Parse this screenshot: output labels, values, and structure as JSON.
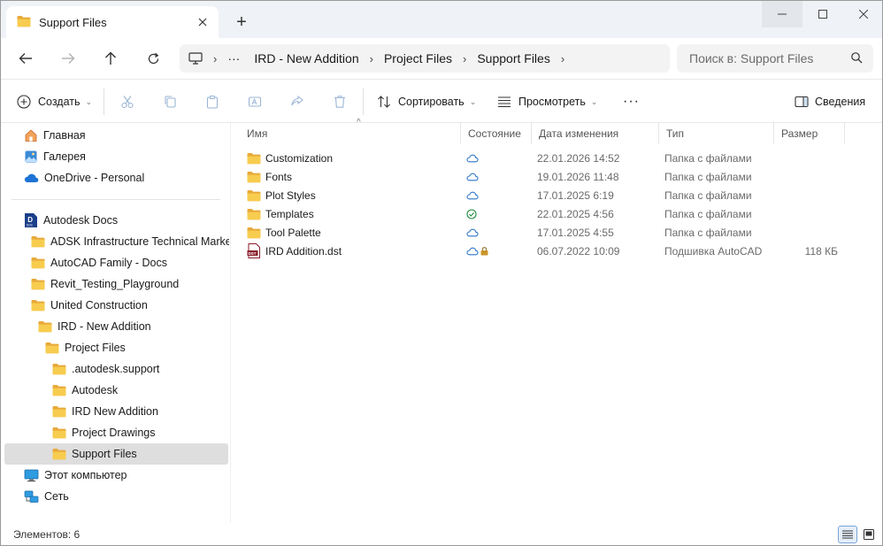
{
  "tab": {
    "title": "Support Files"
  },
  "window": {
    "new_tab": "+"
  },
  "breadcrumb": {
    "ellipsis": "···",
    "items": [
      "IRD - New Addition",
      "Project Files",
      "Support Files"
    ]
  },
  "search": {
    "placeholder": "Поиск в: Support Files"
  },
  "toolbar": {
    "create": "Создать",
    "sort": "Сортировать",
    "view": "Просмотреть",
    "more": "···",
    "details": "Сведения"
  },
  "sidebar": {
    "home": "Главная",
    "gallery": "Галерея",
    "onedrive": "OneDrive - Personal",
    "autodesk_docs": "Autodesk Docs",
    "folders": [
      "ADSK Infrastructure Technical Marketing",
      "AutoCAD Family - Docs",
      "Revit_Testing_Playground",
      "United Construction",
      "IRD - New Addition",
      "Project Files",
      ".autodesk.support",
      "Autodesk",
      "IRD New Addition",
      "Project Drawings",
      "Support Files"
    ],
    "this_pc": "Этот компьютер",
    "network": "Сеть"
  },
  "columns": {
    "name": "Имя",
    "state": "Состояние",
    "date": "Дата изменения",
    "type": "Тип",
    "size": "Размер"
  },
  "files": [
    {
      "name": "Customization",
      "state": "cloud",
      "date": "22.01.2026 14:52",
      "type": "Папка с файлами",
      "size": ""
    },
    {
      "name": "Fonts",
      "state": "cloud",
      "date": "19.01.2026 11:48",
      "type": "Папка с файлами",
      "size": ""
    },
    {
      "name": "Plot Styles",
      "state": "cloud",
      "date": "17.01.2025 6:19",
      "type": "Папка с файлами",
      "size": ""
    },
    {
      "name": "Templates",
      "state": "synced",
      "date": "22.01.2025 4:56",
      "type": "Папка с файлами",
      "size": ""
    },
    {
      "name": "Tool Palette",
      "state": "cloud",
      "date": "17.01.2025 4:55",
      "type": "Папка с файлами",
      "size": ""
    },
    {
      "name": "IRD Addition.dst",
      "state": "cloud-locked",
      "date": "06.07.2022 10:09",
      "type": "Подшивка AutoCAD",
      "size": "118 КБ"
    }
  ],
  "status": {
    "items_count": "Элементов: 6"
  },
  "colors": {
    "folder": "#f5c443",
    "cloud": "#2a73c5",
    "synced": "#1f8b3c",
    "selection": "#dedede"
  }
}
